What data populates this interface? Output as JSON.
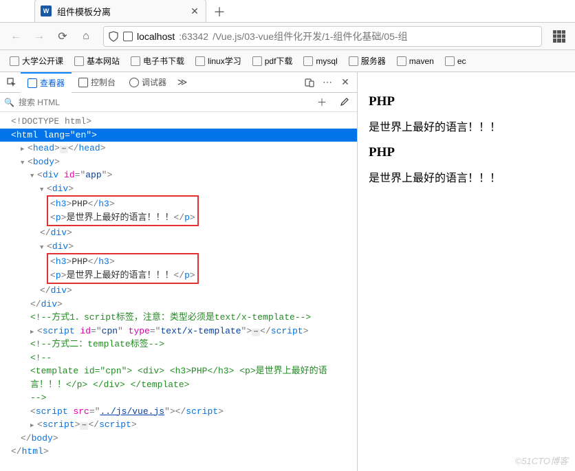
{
  "tab": {
    "title": "组件模板分离"
  },
  "url": {
    "host": "localhost",
    "port": ":63342",
    "path": "/Vue.js/03-vue组件化开发/1-组件化基础/05-组"
  },
  "bookmarks": [
    "大学公开课",
    "基本网站",
    "电子书下载",
    "linux学习",
    "pdf下载",
    "mysql",
    "服务器",
    "maven",
    "ec"
  ],
  "devtools": {
    "tabs": {
      "inspector": "查看器",
      "console": "控制台",
      "debugger": "调试器"
    },
    "search_placeholder": "搜索 HTML",
    "code": {
      "doctype": "<!DOCTYPE html>",
      "html_open": "<html lang=\"en\">",
      "head": "<head>…</head>",
      "body_open": "<body>",
      "div_app": "<div id=\"app\">",
      "div_open": "<div>",
      "div_close": "</div>",
      "h3_php": "<h3>PHP</h3>",
      "p_text": "<p>是世界上最好的语言！！！</p>",
      "cmt_script": "<!--方式1．script标签，注意：类型必须是text/x-template-->",
      "script_tpl": "<script id=\"cpn\" type=\"text/x-template\">…</script>",
      "cmt_tpl": "<!--方式二：template标签-->",
      "cmt_open": "<!--",
      "tpl_line1": "<template id=\"cpn\"> <div> <h3>PHP</h3> <p>是世界上最好的语",
      "tpl_line2": "言！！！</p> </div> </template>",
      "cmt_close": "-->",
      "script_vue": "<script src=\"../js/vue.js\"></script>",
      "script_empty": "<script>…</script>",
      "body_close": "</body>",
      "html_close": "</html>"
    }
  },
  "preview": {
    "heading": "PHP",
    "paragraph": "是世界上最好的语言！！！"
  },
  "watermark": "©51CTO博客"
}
